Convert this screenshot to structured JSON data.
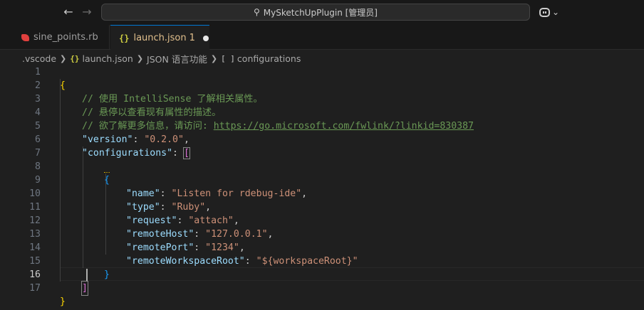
{
  "titlebar": {
    "search_text": "MySketchUpPlugin [管理员]",
    "back_icon": "arrow-left-icon",
    "forward_icon": "arrow-right-icon"
  },
  "tabs": [
    {
      "label": "sine_points.rb",
      "icon": "ruby-file-icon",
      "active": false
    },
    {
      "label": "launch.json",
      "icon": "json-file-icon",
      "badge": "1",
      "active": true,
      "dirty": true
    }
  ],
  "breadcrumb": {
    "folder": ".vscode",
    "file": "launch.json",
    "language": "JSON 语言功能",
    "symbol": "configurations"
  },
  "editor": {
    "active_line": 16,
    "line_numbers": [
      "1",
      "2",
      "3",
      "4",
      "5",
      "6",
      "7",
      "8",
      "9",
      "10",
      "11",
      "12",
      "13",
      "14",
      "15",
      "16",
      "17"
    ],
    "comment1": "// 使用 IntelliSense 了解相关属性。",
    "comment2": "// 悬停以查看现有属性的描述。",
    "comment3_prefix": "// 欲了解更多信息，请访问: ",
    "comment3_url": "https://go.microsoft.com/fwlink/?linkid=830387",
    "version_key": "\"version\"",
    "version_val": "\"0.2.0\"",
    "configurations_key": "\"configurations\"",
    "props": [
      {
        "key": "\"name\"",
        "value": "\"Listen for rdebug-ide\"",
        "comma": ","
      },
      {
        "key": "\"type\"",
        "value": "\"Ruby\"",
        "comma": ","
      },
      {
        "key": "\"request\"",
        "value": "\"attach\"",
        "comma": ","
      },
      {
        "key": "\"remoteHost\"",
        "value": "\"127.0.0.1\"",
        "comma": ","
      },
      {
        "key": "\"remotePort\"",
        "value": "\"1234\"",
        "comma": ","
      },
      {
        "key": "\"remoteWorkspaceRoot\"",
        "value": "\"${workspaceRoot}\"",
        "comma": ""
      }
    ]
  },
  "colors": {
    "background": "#1f1f1f",
    "comment": "#6a9955",
    "key": "#9cdcfe",
    "string": "#ce9178",
    "bracket_level1": "#ffd700",
    "bracket_level2": "#da70d6",
    "bracket_level3": "#179fff",
    "modified_tab": "#e2c08d"
  }
}
